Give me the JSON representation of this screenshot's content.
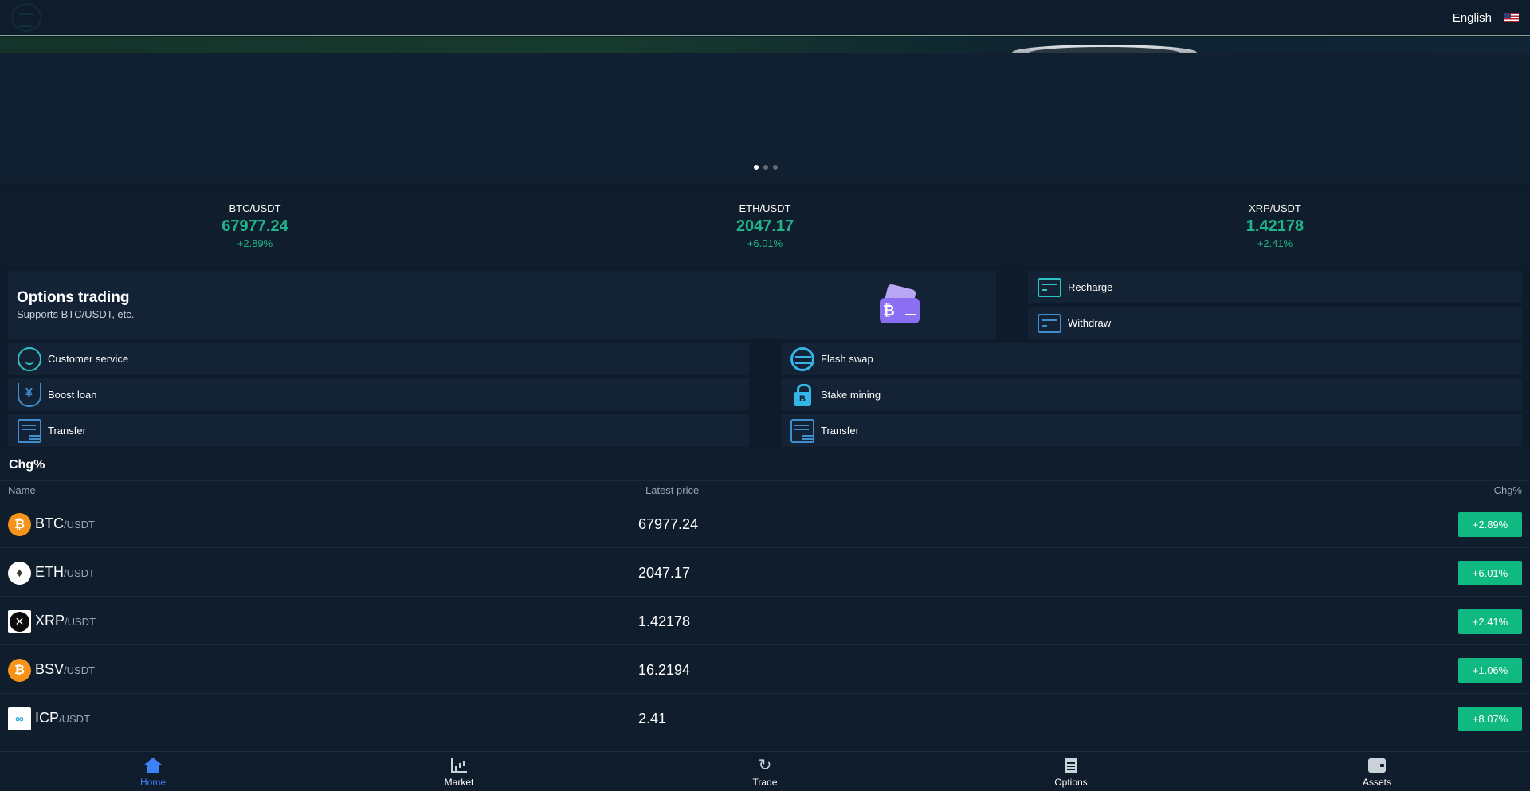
{
  "header": {
    "language": "English",
    "flag_icon": "us-flag-icon"
  },
  "banner": {
    "slide_count": 3,
    "active_slide": 0
  },
  "tickers": [
    {
      "pair": "BTC/USDT",
      "price": "67977.24",
      "change": "+2.89%"
    },
    {
      "pair": "ETH/USDT",
      "price": "2047.17",
      "change": "+6.01%"
    },
    {
      "pair": "XRP/USDT",
      "price": "1.42178",
      "change": "+2.41%"
    }
  ],
  "options_card": {
    "title": "Options trading",
    "subtitle": "Supports BTC/USDT, etc."
  },
  "quick_actions": {
    "recharge": "Recharge",
    "withdraw": "Withdraw",
    "customer_service": "Customer service",
    "flash_swap": "Flash swap",
    "boost_loan": "Boost loan",
    "stake_mining": "Stake mining",
    "transfer_left": "Transfer",
    "transfer_right": "Transfer"
  },
  "market": {
    "title": "Chg%",
    "columns": {
      "name": "Name",
      "price": "Latest price",
      "change": "Chg%"
    },
    "rows": [
      {
        "symbol": "BTC",
        "quote": "/USDT",
        "price": "67977.24",
        "change": "+2.89%"
      },
      {
        "symbol": "ETH",
        "quote": "/USDT",
        "price": "2047.17",
        "change": "+6.01%"
      },
      {
        "symbol": "XRP",
        "quote": "/USDT",
        "price": "1.42178",
        "change": "+2.41%"
      },
      {
        "symbol": "BSV",
        "quote": "/USDT",
        "price": "16.2194",
        "change": "+1.06%"
      },
      {
        "symbol": "ICP",
        "quote": "/USDT",
        "price": "2.41",
        "change": "+8.07%"
      }
    ]
  },
  "nav": {
    "home": "Home",
    "market": "Market",
    "trade": "Trade",
    "options": "Options",
    "assets": "Assets",
    "active": "home"
  },
  "colors": {
    "background": "#0d1b2a",
    "positive": "#1fb48a",
    "badge": "#10b981",
    "active_nav": "#3b82f6"
  }
}
